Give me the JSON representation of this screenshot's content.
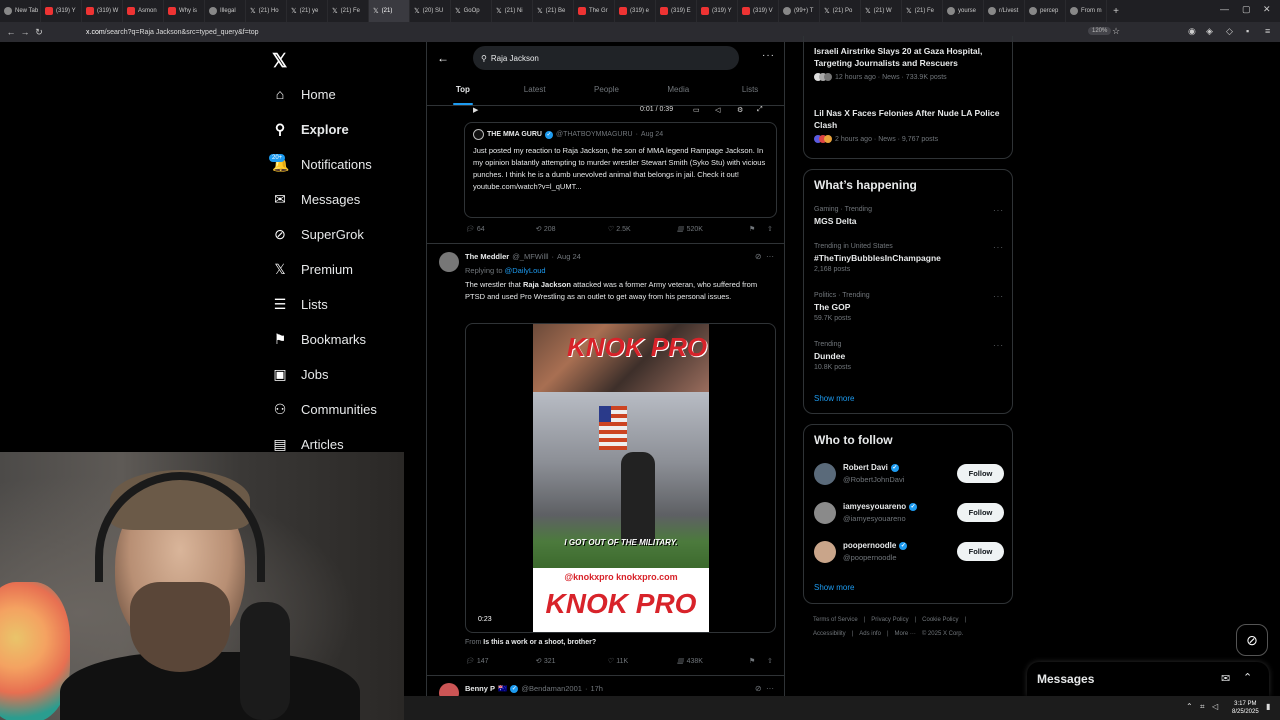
{
  "browser": {
    "tabs": [
      {
        "label": "New Tab",
        "fav": "dot"
      },
      {
        "label": "(319) Y",
        "fav": "yt"
      },
      {
        "label": "(319) W",
        "fav": "yt"
      },
      {
        "label": "Asmon",
        "fav": "yt"
      },
      {
        "label": "Why is",
        "fav": "yt"
      },
      {
        "label": "Illegal",
        "fav": "dot"
      },
      {
        "label": "(21) Ho",
        "fav": "x"
      },
      {
        "label": "(21) ye",
        "fav": "x"
      },
      {
        "label": "(21) Fe",
        "fav": "x"
      },
      {
        "label": "(21)",
        "fav": "x",
        "active": true
      },
      {
        "label": "(20) SU",
        "fav": "x"
      },
      {
        "label": "GoOp",
        "fav": "x"
      },
      {
        "label": "(21) Ni",
        "fav": "x"
      },
      {
        "label": "(21) Be",
        "fav": "x"
      },
      {
        "label": "The Gr",
        "fav": "yt"
      },
      {
        "label": "(319) e",
        "fav": "yt"
      },
      {
        "label": "(319) E",
        "fav": "yt"
      },
      {
        "label": "(319) Y",
        "fav": "yt"
      },
      {
        "label": "(319) V",
        "fav": "yt"
      },
      {
        "label": "(99+) T",
        "fav": "dot"
      },
      {
        "label": "(21) Po",
        "fav": "x"
      },
      {
        "label": "(21) W",
        "fav": "x"
      },
      {
        "label": "(21) Fe",
        "fav": "x"
      },
      {
        "label": "yourse",
        "fav": "dot"
      },
      {
        "label": "r/Livest",
        "fav": "dot"
      },
      {
        "label": "percep",
        "fav": "dot"
      },
      {
        "label": "From m",
        "fav": "dot"
      }
    ],
    "url_domain": "x.com",
    "url_path": "/search?q=Raja Jackson&src=typed_query&f=top",
    "zoom": "120%"
  },
  "nav": {
    "logo": "𝕏",
    "notif_badge": "20+",
    "items": [
      {
        "label": "Home",
        "icon": "⌂"
      },
      {
        "label": "Explore",
        "icon": "⚲"
      },
      {
        "label": "Notifications",
        "icon": "🔔"
      },
      {
        "label": "Messages",
        "icon": "✉"
      },
      {
        "label": "SuperGrok",
        "icon": "⊘"
      },
      {
        "label": "Premium",
        "icon": "𝕏"
      },
      {
        "label": "Lists",
        "icon": "☰"
      },
      {
        "label": "Bookmarks",
        "icon": "⚑"
      },
      {
        "label": "Jobs",
        "icon": "▣"
      },
      {
        "label": "Communities",
        "icon": "⚇"
      },
      {
        "label": "Articles",
        "icon": "▤"
      }
    ]
  },
  "search": {
    "query": "Raja Jackson",
    "tabs": [
      "Top",
      "Latest",
      "People",
      "Media",
      "Lists"
    ]
  },
  "video_controls": {
    "time": "0:01 / 0:39"
  },
  "quote": {
    "name": "THE MMA GURU",
    "handle": "@THATBOYMMAGURU",
    "date": "Aug 24",
    "text": "Just posted my reaction to Raja Jackson, the son of MMA legend Rampage Jackson. In my opinion blatantly attempting to murder wrestler Stewart Smith (Syko Stu) with vicious punches. I think he is a dumb unevolved animal that belongs in jail. Check it out! youtube.com/watch?v=l_qUMT..."
  },
  "actions1": {
    "replies": "64",
    "reposts": "208",
    "likes": "2.5K",
    "views": "520K"
  },
  "post2": {
    "name": "The Meddler",
    "handle": "@_MFWilll",
    "date": "Aug 24",
    "replying_prefix": "Replying to",
    "replying_to": "@DailyLoud",
    "text_before": "The wrestler that ",
    "text_bold": "Raja Jackson",
    "text_after": " attacked was a former Army veteran, who suffered from PTSD and used Pro Wrestling as an outlet to get away from his personal issues.",
    "video_brand": "KNOK PRO",
    "video_caption": "I GOT OUT OF THE MILITARY.",
    "video_social": "@knokxpro   knokxpro.com",
    "video_brand_bottom": "KNOK PRO",
    "video_time": "0:23",
    "from_prefix": "From",
    "from_title": "Is this a work or a shoot, brother?"
  },
  "actions2": {
    "replies": "147",
    "reposts": "321",
    "likes": "11K",
    "views": "438K"
  },
  "post3": {
    "name": "Benny P",
    "flag": "🇦🇺",
    "handle": "@Bendaman2001",
    "date": "17h"
  },
  "news": [
    {
      "title": "Israeli Airstrike Slays 20 at Gaza Hospital, Targeting Journalists and Rescuers",
      "meta": "12 hours ago · News · 733.9K posts"
    },
    {
      "title": "Lil Nas X Faces Felonies After Nude LA Police Clash",
      "meta": "2 hours ago · News · 9,767 posts"
    }
  ],
  "happening": {
    "title": "What’s happening",
    "trends": [
      {
        "context": "Gaming · Trending",
        "name": "MGS Delta",
        "count": ""
      },
      {
        "context": "Trending in United States",
        "name": "#TheTinyBubblesInChampagne",
        "count": "2,168 posts"
      },
      {
        "context": "Politics · Trending",
        "name": "The GOP",
        "count": "59.7K posts"
      },
      {
        "context": "Trending",
        "name": "Dundee",
        "count": "10.8K posts"
      }
    ],
    "show_more": "Show more"
  },
  "who_to_follow": {
    "title": "Who to follow",
    "accounts": [
      {
        "name": "Robert Davi",
        "handle": "@RobertJohnDavi",
        "button": "Follow"
      },
      {
        "name": "iamyesyouareno",
        "handle": "@iamyesyouareno",
        "button": "Follow"
      },
      {
        "name": "poopernoodle",
        "handle": "@poopernoodle",
        "button": "Follow"
      }
    ],
    "show_more": "Show more"
  },
  "footer": {
    "line1": [
      "Terms of Service",
      "|",
      "Privacy Policy",
      "|",
      "Cookie Policy",
      "|"
    ],
    "line2": [
      "Accessibility",
      "|",
      "Ads info",
      "|",
      "More ···",
      "© 2025 X Corp."
    ]
  },
  "messages_drawer": {
    "label": "Messages"
  },
  "clock": {
    "time": "3:17 PM",
    "date": "8/25/2025"
  }
}
